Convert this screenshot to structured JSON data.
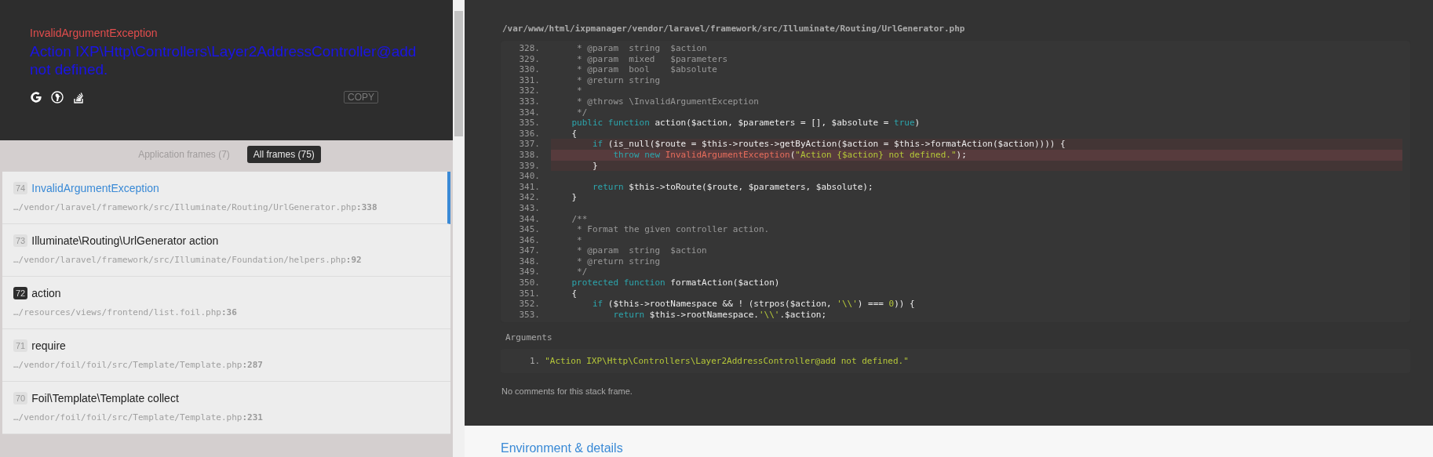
{
  "exception": {
    "class": "InvalidArgumentException",
    "message": "Action IXP\\Http\\Controllers\\Layer2AddressController@add not defined.",
    "copy_button": "COPY"
  },
  "frame_tabs": [
    {
      "label": "Application frames (7)",
      "selected": false
    },
    {
      "label": "All frames (75)",
      "selected": true
    }
  ],
  "frames": [
    {
      "number": "74",
      "title": "InvalidArgumentException",
      "path": "…/vendor/laravel/framework/src/Illuminate/Routing/UrlGenerator.php",
      "line": ":338",
      "selected": true,
      "application": false
    },
    {
      "number": "73",
      "title": "Illuminate\\Routing\\UrlGenerator action",
      "path": "…/vendor/laravel/framework/src/Illuminate/Foundation/helpers.php",
      "line": ":92",
      "selected": false,
      "application": false
    },
    {
      "number": "72",
      "title": "action",
      "path": "…/resources/views/frontend/list.foil.php",
      "line": ":36",
      "selected": false,
      "application": true
    },
    {
      "number": "71",
      "title": "require",
      "path": "…/vendor/foil/foil/src/Template/Template.php",
      "line": ":287",
      "selected": false,
      "application": false
    },
    {
      "number": "70",
      "title": "Foil\\Template\\Template collect",
      "path": "…/vendor/foil/foil/src/Template/Template.php",
      "line": ":231",
      "selected": false,
      "application": false
    }
  ],
  "code": {
    "file": "/var/www/html/ixpmanager/vendor/laravel/framework/src/Illuminate/Routing/UrlGenerator.php",
    "lines": [
      {
        "number": "328.",
        "highlighted": false,
        "error": false,
        "tokens": [
          {
            "kind": "comment",
            "text": "     * @param  string  $action"
          }
        ]
      },
      {
        "number": "329.",
        "highlighted": false,
        "error": false,
        "tokens": [
          {
            "kind": "comment",
            "text": "     * @param  mixed   $parameters"
          }
        ]
      },
      {
        "number": "330.",
        "highlighted": false,
        "error": false,
        "tokens": [
          {
            "kind": "comment",
            "text": "     * @param  bool    $absolute"
          }
        ]
      },
      {
        "number": "331.",
        "highlighted": false,
        "error": false,
        "tokens": [
          {
            "kind": "comment",
            "text": "     * @return string"
          }
        ]
      },
      {
        "number": "332.",
        "highlighted": false,
        "error": false,
        "tokens": [
          {
            "kind": "comment",
            "text": "     *"
          }
        ]
      },
      {
        "number": "333.",
        "highlighted": false,
        "error": false,
        "tokens": [
          {
            "kind": "comment",
            "text": "     * @throws \\InvalidArgumentException"
          }
        ]
      },
      {
        "number": "334.",
        "highlighted": false,
        "error": false,
        "tokens": [
          {
            "kind": "comment",
            "text": "     */"
          }
        ]
      },
      {
        "number": "335.",
        "highlighted": false,
        "error": false,
        "tokens": [
          {
            "kind": "keyword",
            "text": "    public function "
          },
          {
            "kind": "plain",
            "text": "action($action, $parameters = [], $absolute = "
          },
          {
            "kind": "keyword",
            "text": "true"
          },
          {
            "kind": "plain",
            "text": ")"
          }
        ]
      },
      {
        "number": "336.",
        "highlighted": false,
        "error": false,
        "tokens": [
          {
            "kind": "plain",
            "text": "    {"
          }
        ]
      },
      {
        "number": "337.",
        "highlighted": true,
        "error": false,
        "tokens": [
          {
            "kind": "keyword",
            "text": "        if "
          },
          {
            "kind": "plain",
            "text": "(is_null($route = $this->routes->getByAction($action = $this->formatAction($action)))) {"
          }
        ]
      },
      {
        "number": "338.",
        "highlighted": true,
        "error": true,
        "tokens": [
          {
            "kind": "keyword",
            "text": "            throw new "
          },
          {
            "kind": "class",
            "text": "InvalidArgumentException"
          },
          {
            "kind": "plain",
            "text": "("
          },
          {
            "kind": "string",
            "text": "\"Action {$action} not defined.\""
          },
          {
            "kind": "plain",
            "text": ");"
          }
        ]
      },
      {
        "number": "339.",
        "highlighted": true,
        "error": false,
        "tokens": [
          {
            "kind": "plain",
            "text": "        }"
          }
        ]
      },
      {
        "number": "340.",
        "highlighted": false,
        "error": false
      },
      {
        "number": "341.",
        "highlighted": false,
        "error": false,
        "tokens": [
          {
            "kind": "keyword",
            "text": "        return "
          },
          {
            "kind": "plain",
            "text": "$this->toRoute($route, $parameters, $absolute);"
          }
        ]
      },
      {
        "number": "342.",
        "highlighted": false,
        "error": false,
        "tokens": [
          {
            "kind": "plain",
            "text": "    }"
          }
        ]
      },
      {
        "number": "343.",
        "highlighted": false,
        "error": false
      },
      {
        "number": "344.",
        "highlighted": false,
        "error": false,
        "tokens": [
          {
            "kind": "comment",
            "text": "    /**"
          }
        ]
      },
      {
        "number": "345.",
        "highlighted": false,
        "error": false,
        "tokens": [
          {
            "kind": "comment",
            "text": "     * Format the given controller action."
          }
        ]
      },
      {
        "number": "346.",
        "highlighted": false,
        "error": false,
        "tokens": [
          {
            "kind": "comment",
            "text": "     *"
          }
        ]
      },
      {
        "number": "347.",
        "highlighted": false,
        "error": false,
        "tokens": [
          {
            "kind": "comment",
            "text": "     * @param  string  $action"
          }
        ]
      },
      {
        "number": "348.",
        "highlighted": false,
        "error": false,
        "tokens": [
          {
            "kind": "comment",
            "text": "     * @return string"
          }
        ]
      },
      {
        "number": "349.",
        "highlighted": false,
        "error": false,
        "tokens": [
          {
            "kind": "comment",
            "text": "     */"
          }
        ]
      },
      {
        "number": "350.",
        "highlighted": false,
        "error": false,
        "tokens": [
          {
            "kind": "keyword",
            "text": "    protected function "
          },
          {
            "kind": "plain",
            "text": "formatAction($action)"
          }
        ]
      },
      {
        "number": "351.",
        "highlighted": false,
        "error": false,
        "tokens": [
          {
            "kind": "plain",
            "text": "    {"
          }
        ]
      },
      {
        "number": "352.",
        "highlighted": false,
        "error": false,
        "tokens": [
          {
            "kind": "keyword",
            "text": "        if "
          },
          {
            "kind": "plain",
            "text": "($this->rootNamespace && ! (strpos($action, "
          },
          {
            "kind": "string",
            "text": "'\\\\'"
          },
          {
            "kind": "plain",
            "text": ") === "
          },
          {
            "kind": "number",
            "text": "0"
          },
          {
            "kind": "plain",
            "text": ")) {"
          }
        ]
      },
      {
        "number": "353.",
        "highlighted": false,
        "error": false,
        "tokens": [
          {
            "kind": "keyword",
            "text": "            return "
          },
          {
            "kind": "plain",
            "text": "$this->rootNamespace."
          },
          {
            "kind": "string",
            "text": "'\\\\'"
          },
          {
            "kind": "plain",
            "text": ".$action;"
          }
        ]
      }
    ]
  },
  "arguments": {
    "title": "Arguments",
    "items": [
      {
        "number": "1.",
        "value": "\"Action IXP\\Http\\Controllers\\Layer2AddressController@add not defined.\""
      }
    ]
  },
  "comments_note": "No comments for this stack frame.",
  "next_section_title": "Environment & details"
}
